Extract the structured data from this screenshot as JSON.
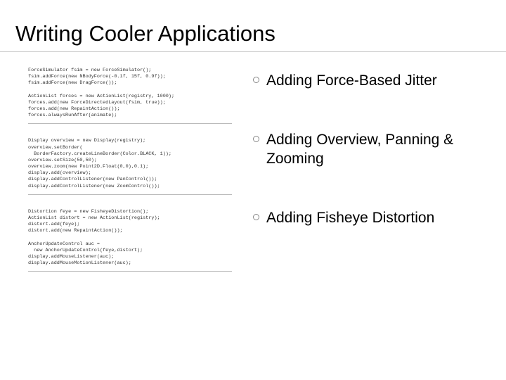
{
  "title": "Writing Cooler Applications",
  "bullets": [
    {
      "text": "Adding Force-Based Jitter"
    },
    {
      "text": "Adding Overview, Panning & Zooming"
    },
    {
      "text": "Adding Fisheye Distortion"
    }
  ],
  "code_blocks": [
    "ForceSimulator fsim = new ForceSimulator();\nfsim.addForce(new NBodyForce(-0.1f, 15f, 0.9f));\nfsim.addForce(new DragForce());\n\nActionList forces = new ActionList(registry, 1000);\nforces.add(new ForceDirectedLayout(fsim, true));\nforces.add(new RepaintAction());\nforces.alwaysRunAfter(animate);",
    "Display overview = new Display(registry);\noverview.setBorder(\n  BorderFactory.createLineBorder(Color.BLACK, 1));\noverview.setSize(50,50);\noverview.zoom(new Point2D.Float(0,0),0.1);\ndisplay.add(overview);\ndisplay.addControlListener(new PanControl());\ndisplay.addControlListener(new ZoomControl());",
    "Distortion feye = new FisheyeDistortion();\nActionList distort = new ActionList(registry);\ndistort.add(feye);\ndistort.add(new RepaintAction());\n\nAnchorUpdateControl auc =\n  new AnchorUpdateControl(feye,distort);\ndisplay.addMouseListener(auc);\ndisplay.addMouseMotionListener(auc);"
  ]
}
